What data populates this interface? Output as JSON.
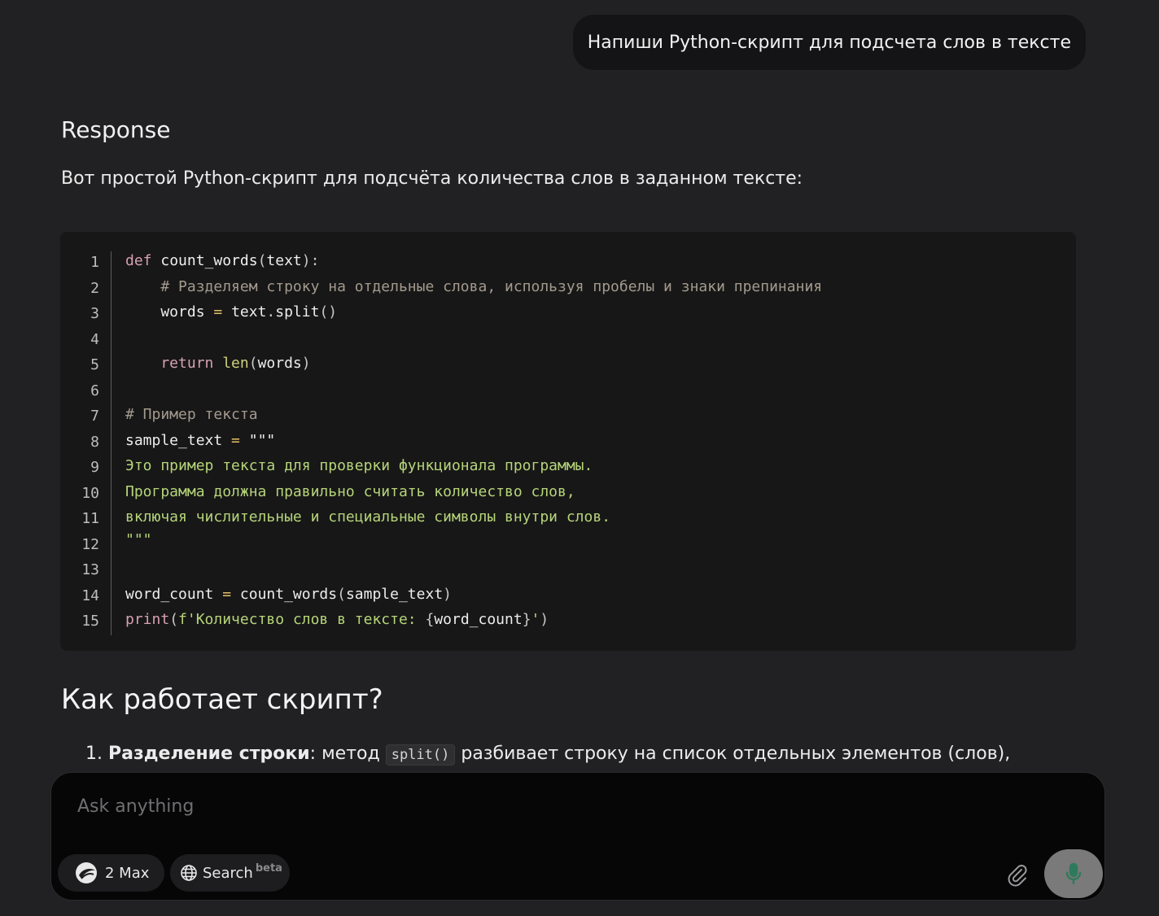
{
  "user_message": "Напиши Python-скрипт для подсчета слов в тексте",
  "response_label": "Response",
  "intro": "Вот простой Python-скрипт для подсчёта количества слов в заданном тексте:",
  "code": {
    "line_numbers": [
      "1",
      "2",
      "3",
      "4",
      "5",
      "6",
      "7",
      "8",
      "9",
      "10",
      "11",
      "12",
      "13",
      "14",
      "15"
    ],
    "l1": {
      "kw": "def",
      "name": " count_words",
      "open": "(",
      "arg": "text",
      "close": "):"
    },
    "l2": {
      "comment": "    # Разделяем строку на отдельные слова, используя пробелы и знаки препинания"
    },
    "l3": {
      "var": "    words",
      "op": " = ",
      "obj": "text",
      "dot": ".",
      "meth": "split",
      "paren": "()"
    },
    "l5": {
      "kw": "    return",
      "sp": " ",
      "fn": "len",
      "open": "(",
      "arg": "words",
      "close": ")"
    },
    "l7": {
      "comment": "# Пример текста"
    },
    "l8": {
      "var": "sample_text",
      "op": " = ",
      "str": "\"\"\""
    },
    "l9": {
      "str": "Это пример текста для проверки функционала программы."
    },
    "l10": {
      "str": "Программа должна правильно считать количество слов,"
    },
    "l11": {
      "str": "включая числительные и специальные символы внутри слов."
    },
    "l12": {
      "str": "\"\"\""
    },
    "l14": {
      "var": "word_count",
      "op": " = ",
      "fn": "count_words",
      "open": "(",
      "arg": "sample_text",
      "close": ")"
    },
    "l15": {
      "fn": "print",
      "open": "(",
      "str1": "f'Количество слов в тексте: ",
      "brace_open": "{",
      "arg": "word_count",
      "brace_close": "}",
      "str2": "'",
      "close": ")"
    }
  },
  "section_heading": "Как работает скрипт?",
  "list": {
    "number": "1.",
    "bold": "Разделение строки",
    "text_before": ": метод ",
    "code": "split()",
    "text_after": " разбивает строку на список отдельных элементов (слов),"
  },
  "composer": {
    "placeholder": "Ask anything",
    "model_label": "2 Max",
    "search_label": "Search",
    "search_badge": "beta",
    "icons": {
      "model": "model-logo-icon",
      "search": "globe-icon",
      "attach": "paperclip-icon",
      "mic": "microphone-icon"
    }
  },
  "colors": {
    "background": "#212123",
    "code_bg": "#171717",
    "keyword": "#d7a0b4",
    "string": "#b6d47a",
    "comment": "#a39a8e",
    "mic_button": "#7a7a7b",
    "mic_icon": "#2f7a5c"
  }
}
